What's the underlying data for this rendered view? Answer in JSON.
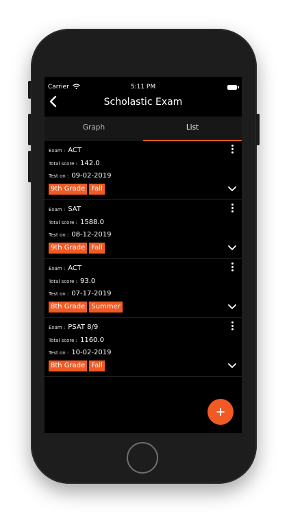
{
  "status": {
    "carrier": "Carrier",
    "time": "5:11 PM"
  },
  "nav": {
    "title": "Scholastic Exam"
  },
  "tabs": [
    "Graph",
    "List"
  ],
  "labels": {
    "exam": "Exam :",
    "total": "Total score :",
    "test": "Test on :"
  },
  "records": [
    {
      "exam": "ACT",
      "score": "142.0",
      "date": "09-02-2019",
      "grade": "9th Grade",
      "term": "Fall"
    },
    {
      "exam": "SAT",
      "score": "1588.0",
      "date": "08-12-2019",
      "grade": "9th Grade",
      "term": "Fall"
    },
    {
      "exam": "ACT",
      "score": "93.0",
      "date": "07-17-2019",
      "grade": "8th Grade",
      "term": "Summer"
    },
    {
      "exam": "PSAT 8/9",
      "score": "1160.0",
      "date": "10-02-2019",
      "grade": "8th Grade",
      "term": "Fall"
    }
  ],
  "fab": {
    "label": "+"
  },
  "colors": {
    "accent": "#f15a24",
    "background": "#000000",
    "tab_bar": "#171717"
  }
}
